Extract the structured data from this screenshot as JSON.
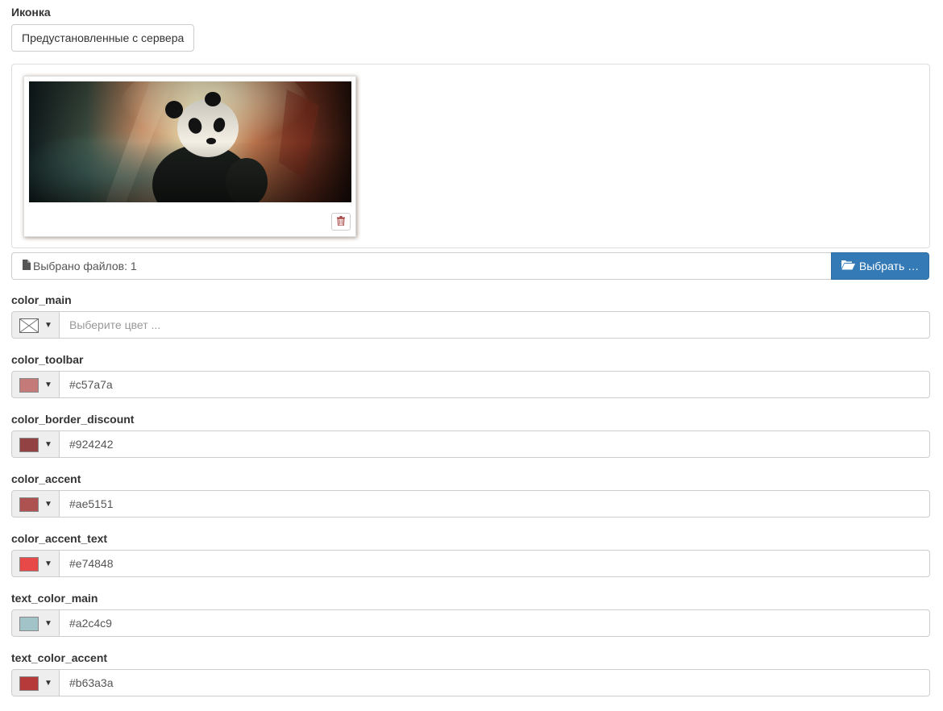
{
  "icon_section": {
    "label": "Иконка",
    "preset_button_label": "Предустановленные с сервера",
    "delete_icon": "trash-icon",
    "file_caption_icon": "file-icon",
    "file_caption_text": "Выбрано файлов: 1",
    "browse_icon": "folder-open-icon",
    "browse_button_label": "Выбрать …"
  },
  "colors": [
    {
      "label": "color_main",
      "value": "",
      "placeholder": "Выберите цвет ...",
      "swatch": "none"
    },
    {
      "label": "color_toolbar",
      "value": "#c57a7a",
      "placeholder": "",
      "swatch": "#c57a7a"
    },
    {
      "label": "color_border_discount",
      "value": "#924242",
      "placeholder": "",
      "swatch": "#924242"
    },
    {
      "label": "color_accent",
      "value": "#ae5151",
      "placeholder": "",
      "swatch": "#ae5151"
    },
    {
      "label": "color_accent_text",
      "value": "#e74848",
      "placeholder": "",
      "swatch": "#e74848"
    },
    {
      "label": "text_color_main",
      "value": "#a2c4c9",
      "placeholder": "",
      "swatch": "#a2c4c9"
    },
    {
      "label": "text_color_accent",
      "value": "#b63a3a",
      "placeholder": "",
      "swatch": "#b63a3a"
    }
  ],
  "accent_color": "#337ab7",
  "delete_icon_color": "#a94442"
}
